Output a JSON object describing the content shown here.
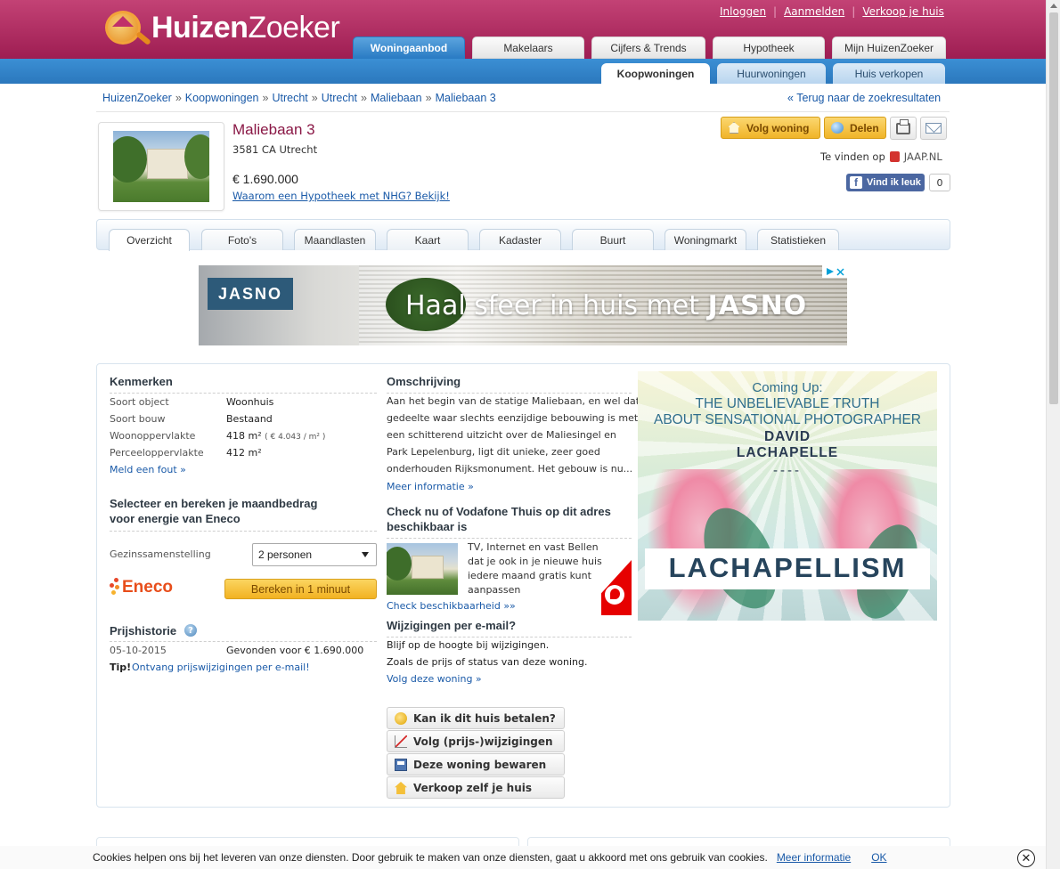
{
  "header": {
    "logo_bold": "Huizen",
    "logo_regular": "Zoeker",
    "toplinks": [
      "Inloggen",
      "Aanmelden",
      "Verkoop je huis"
    ],
    "main_tabs": [
      "Woningaanbod",
      "Makelaars",
      "Cijfers & Trends",
      "Hypotheek",
      "Mijn HuizenZoeker"
    ],
    "sub_tabs": [
      "Koopwoningen",
      "Huurwoningen",
      "Huis verkopen"
    ]
  },
  "breadcrumb": [
    "HuizenZoeker",
    "Koopwoningen",
    "Utrecht",
    "Utrecht",
    "Maliebaan",
    "Maliebaan 3"
  ],
  "breadcrumb_sep": "»",
  "back_link": "« Terug naar de zoekresultaten",
  "property": {
    "title": "Maliebaan 3",
    "address": "3581 CA Utrecht",
    "price": "€ 1.690.000",
    "nhg_link": "Waarom een Hypotheek met NHG? Bekijk!",
    "follow_label": "Volg woning",
    "share_label": "Delen",
    "te_vinden": "Te vinden op",
    "jaap": "JAAP.NL",
    "fb_label": "Vind ik leuk",
    "fb_count": "0"
  },
  "detail_tabs": [
    "Overzicht",
    "Foto's",
    "Maandlasten",
    "Kaart",
    "Kadaster",
    "Buurt",
    "Woningmarkt",
    "Statistieken"
  ],
  "banner": {
    "brand": "JASNO",
    "tagline_pre": "Haal sfeer in huis met ",
    "tagline_brand": "JASNO"
  },
  "kenmerken": {
    "title": "Kenmerken",
    "rows": [
      {
        "label": "Soort object",
        "value": "Woonhuis"
      },
      {
        "label": "Soort bouw",
        "value": "Bestaand"
      },
      {
        "label": "Woonoppervlakte",
        "value": "418 m²",
        "extra": "( € 4.043 / m² )"
      },
      {
        "label": "Perceeloppervlakte",
        "value": "412 m²"
      }
    ],
    "report_link": "Meld een fout »"
  },
  "energy": {
    "title_line1": "Selecteer en bereken je maandbedrag",
    "title_line2": "voor energie van Eneco",
    "field_label": "Gezinssamenstelling",
    "select_value": "2 personen",
    "brand": "Eneco",
    "button": "Bereken in 1 minuut"
  },
  "price_history": {
    "title": "Prijshistorie",
    "help_glyph": "?",
    "date": "05-10-2015",
    "event": "Gevonden voor € 1.690.000",
    "tip_label": "Tip!",
    "tip_link": "Ontvang prijswijzigingen per e-mail!"
  },
  "description": {
    "title": "Omschrijving",
    "lines": [
      "Aan het begin van de statige Maliebaan, en wel dat",
      "gedeelte waar slechts eenzijdige bebouwing is met",
      "een schitterend uitzicht over de Maliesingel en",
      "Park Lepelenburg, ligt dit unieke, zeer goed",
      "onderhouden Rijksmonument. Het gebouw is nu..."
    ],
    "more_link": "Meer informatie »"
  },
  "vodafone": {
    "title_line1": "Check nu of Vodafone Thuis op dit adres",
    "title_line2": "beschikbaar is",
    "lines": [
      "TV, Internet en vast Bellen",
      "dat je ook in je nieuwe huis",
      "iedere maand gratis kunt",
      "aanpassen"
    ],
    "check_link": "Check beschikbaarheid »»"
  },
  "email_alert": {
    "title": "Wijzigingen per e-mail?",
    "line1": "Blijf op de hoogte bij wijzigingen.",
    "line2": "Zoals de prijs of status van deze woning.",
    "link": "Volg deze woning »"
  },
  "actions": [
    "Kan ik dit huis betalen?",
    "Volg (prijs-)wijzigingen",
    "Deze woning bewaren",
    "Verkoop zelf je huis"
  ],
  "right_ad": {
    "coming": "Coming Up:",
    "truth_line1": "THE UNBELIEVABLE TRUTH",
    "truth_line2": "ABOUT SENSATIONAL PHOTOGRAPHER",
    "name_line1": "DAVID",
    "name_line2": "LACHAPELLE",
    "dash": "----",
    "word": "LACHAPELLISM"
  },
  "cookie": {
    "text": "Cookies helpen ons bij het leveren van onze diensten. Door gebruik te maken van onze diensten, gaat u akkoord met ons gebruik van cookies.",
    "more": "Meer informatie",
    "ok": "OK",
    "close_glyph": "✕"
  }
}
